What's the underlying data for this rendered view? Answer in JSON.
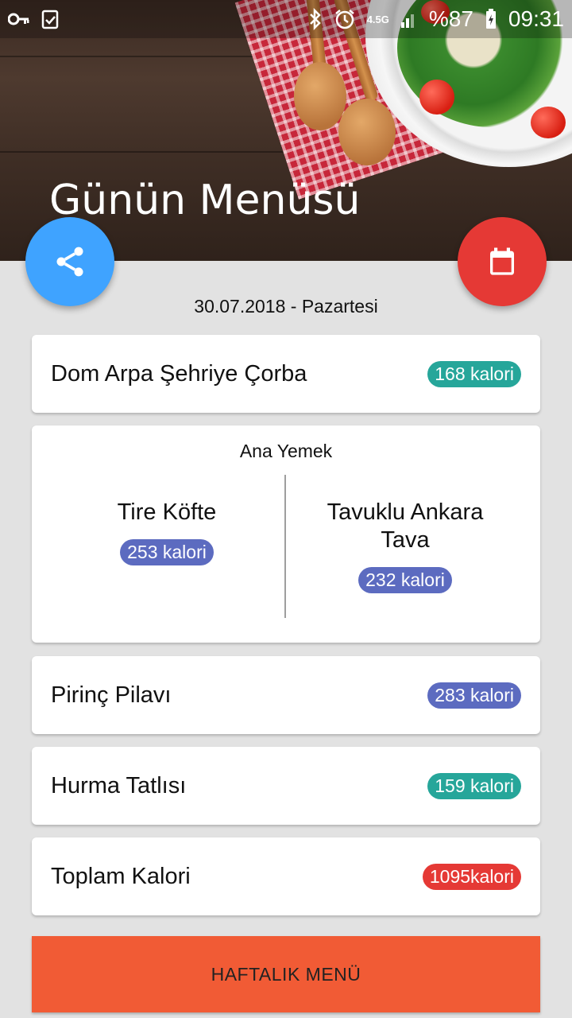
{
  "status_bar": {
    "network": "4.5G",
    "battery": "%87",
    "time": "09:31"
  },
  "header": {
    "title": "Günün Menüsü"
  },
  "fab": {
    "share_icon": "share-icon",
    "calendar_icon": "calendar-icon"
  },
  "date_text": "30.07.2018 - Pazartesi",
  "soup": {
    "name": "Dom Arpa Şehriye Çorba",
    "calories": "168 kalori"
  },
  "main_course": {
    "title": "Ana Yemek",
    "left": {
      "name": "Tire Köfte",
      "calories": "253 kalori"
    },
    "right": {
      "name_line1": "Tavuklu Ankara",
      "name_line2": "Tava",
      "calories": "232 kalori"
    }
  },
  "side": {
    "name": "Pirinç Pilavı",
    "calories": "283 kalori"
  },
  "dessert": {
    "name": "Hurma Tatlısı",
    "calories": "159 kalori"
  },
  "total": {
    "name": "Toplam Kalori",
    "calories": "1095kalori"
  },
  "weekly_button": "HAFTALIK MENÜ",
  "colors": {
    "teal_badge": "#26a69a",
    "indigo_badge": "#5c6bc0",
    "red_badge": "#e53935",
    "share_fab": "#3fa3ff",
    "calendar_fab": "#e53935",
    "weekly_button": "#f15b35"
  }
}
